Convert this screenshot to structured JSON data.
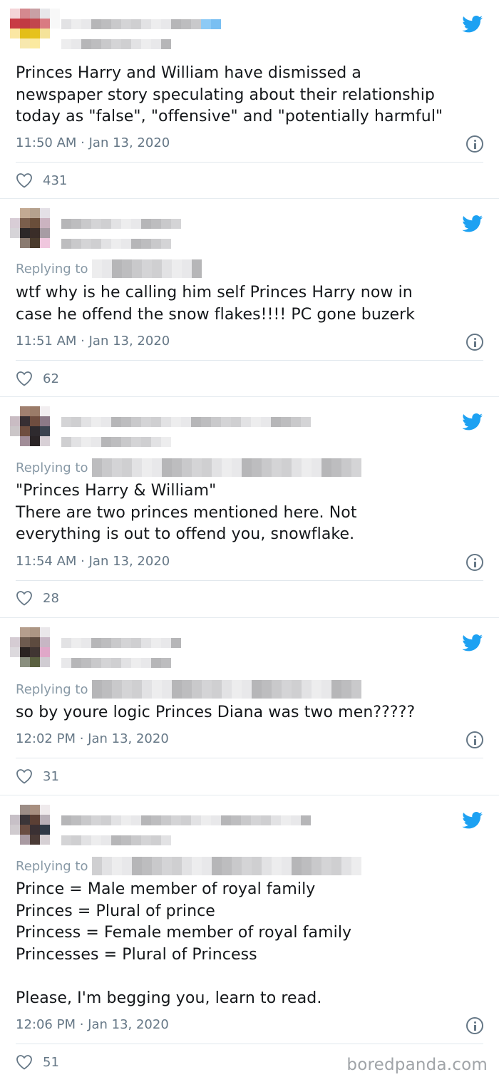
{
  "tweets": [
    {
      "replying_label": "",
      "text": "Princes Harry and William have dismissed a\nnewspaper story speculating about their relationship\ntoday as \"false\", \"offensive\" and \"potentially harmful\"",
      "timestamp": "11:50 AM · Jan 13, 2020",
      "likes": "431"
    },
    {
      "replying_label": "Replying to",
      "text": "wtf why is he calling him self Princes Harry now in\ncase he offend the snow flakes!!!! PC gone buzerk",
      "timestamp": "11:51 AM · Jan 13, 2020",
      "likes": "62"
    },
    {
      "replying_label": "Replying to",
      "text": "\"Princes Harry & William\"\nThere are two princes mentioned here. Not\neverything is out to offend you, snowflake.",
      "timestamp": "11:54 AM · Jan 13, 2020",
      "likes": "28"
    },
    {
      "replying_label": "Replying to",
      "text": "so by youre logic Princes Diana was two men?????",
      "timestamp": "12:02 PM · Jan 13, 2020",
      "likes": "31"
    },
    {
      "replying_label": "Replying to",
      "text": "Prince = Male member of royal family\nPrinces = Plural of prince\nPrincess = Female member of royal family\nPrincesses = Plural of Princess\n\nPlease, I'm begging you, learn to read.",
      "timestamp": "12:06 PM · Jan 13, 2020",
      "likes": "51"
    }
  ],
  "watermark": "boredpanda.com",
  "icons": {
    "brand": "twitter-bird-icon",
    "info": "info-icon",
    "like": "heart-icon"
  },
  "colors": {
    "twitter_blue": "#1da1f2",
    "meta_gray": "#657786",
    "text": "#14171a"
  }
}
